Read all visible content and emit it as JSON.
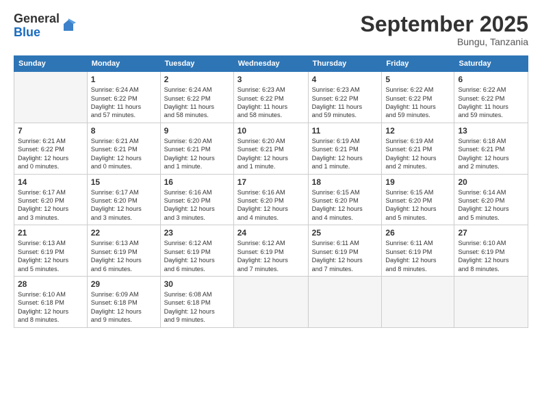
{
  "logo": {
    "general": "General",
    "blue": "Blue"
  },
  "title": "September 2025",
  "location": "Bungu, Tanzania",
  "days_of_week": [
    "Sunday",
    "Monday",
    "Tuesday",
    "Wednesday",
    "Thursday",
    "Friday",
    "Saturday"
  ],
  "weeks": [
    [
      {
        "day": "",
        "info": ""
      },
      {
        "day": "1",
        "info": "Sunrise: 6:24 AM\nSunset: 6:22 PM\nDaylight: 11 hours\nand 57 minutes."
      },
      {
        "day": "2",
        "info": "Sunrise: 6:24 AM\nSunset: 6:22 PM\nDaylight: 11 hours\nand 58 minutes."
      },
      {
        "day": "3",
        "info": "Sunrise: 6:23 AM\nSunset: 6:22 PM\nDaylight: 11 hours\nand 58 minutes."
      },
      {
        "day": "4",
        "info": "Sunrise: 6:23 AM\nSunset: 6:22 PM\nDaylight: 11 hours\nand 59 minutes."
      },
      {
        "day": "5",
        "info": "Sunrise: 6:22 AM\nSunset: 6:22 PM\nDaylight: 11 hours\nand 59 minutes."
      },
      {
        "day": "6",
        "info": "Sunrise: 6:22 AM\nSunset: 6:22 PM\nDaylight: 11 hours\nand 59 minutes."
      }
    ],
    [
      {
        "day": "7",
        "info": "Sunrise: 6:21 AM\nSunset: 6:22 PM\nDaylight: 12 hours\nand 0 minutes."
      },
      {
        "day": "8",
        "info": "Sunrise: 6:21 AM\nSunset: 6:21 PM\nDaylight: 12 hours\nand 0 minutes."
      },
      {
        "day": "9",
        "info": "Sunrise: 6:20 AM\nSunset: 6:21 PM\nDaylight: 12 hours\nand 1 minute."
      },
      {
        "day": "10",
        "info": "Sunrise: 6:20 AM\nSunset: 6:21 PM\nDaylight: 12 hours\nand 1 minute."
      },
      {
        "day": "11",
        "info": "Sunrise: 6:19 AM\nSunset: 6:21 PM\nDaylight: 12 hours\nand 1 minute."
      },
      {
        "day": "12",
        "info": "Sunrise: 6:19 AM\nSunset: 6:21 PM\nDaylight: 12 hours\nand 2 minutes."
      },
      {
        "day": "13",
        "info": "Sunrise: 6:18 AM\nSunset: 6:21 PM\nDaylight: 12 hours\nand 2 minutes."
      }
    ],
    [
      {
        "day": "14",
        "info": "Sunrise: 6:17 AM\nSunset: 6:20 PM\nDaylight: 12 hours\nand 3 minutes."
      },
      {
        "day": "15",
        "info": "Sunrise: 6:17 AM\nSunset: 6:20 PM\nDaylight: 12 hours\nand 3 minutes."
      },
      {
        "day": "16",
        "info": "Sunrise: 6:16 AM\nSunset: 6:20 PM\nDaylight: 12 hours\nand 3 minutes."
      },
      {
        "day": "17",
        "info": "Sunrise: 6:16 AM\nSunset: 6:20 PM\nDaylight: 12 hours\nand 4 minutes."
      },
      {
        "day": "18",
        "info": "Sunrise: 6:15 AM\nSunset: 6:20 PM\nDaylight: 12 hours\nand 4 minutes."
      },
      {
        "day": "19",
        "info": "Sunrise: 6:15 AM\nSunset: 6:20 PM\nDaylight: 12 hours\nand 5 minutes."
      },
      {
        "day": "20",
        "info": "Sunrise: 6:14 AM\nSunset: 6:20 PM\nDaylight: 12 hours\nand 5 minutes."
      }
    ],
    [
      {
        "day": "21",
        "info": "Sunrise: 6:13 AM\nSunset: 6:19 PM\nDaylight: 12 hours\nand 5 minutes."
      },
      {
        "day": "22",
        "info": "Sunrise: 6:13 AM\nSunset: 6:19 PM\nDaylight: 12 hours\nand 6 minutes."
      },
      {
        "day": "23",
        "info": "Sunrise: 6:12 AM\nSunset: 6:19 PM\nDaylight: 12 hours\nand 6 minutes."
      },
      {
        "day": "24",
        "info": "Sunrise: 6:12 AM\nSunset: 6:19 PM\nDaylight: 12 hours\nand 7 minutes."
      },
      {
        "day": "25",
        "info": "Sunrise: 6:11 AM\nSunset: 6:19 PM\nDaylight: 12 hours\nand 7 minutes."
      },
      {
        "day": "26",
        "info": "Sunrise: 6:11 AM\nSunset: 6:19 PM\nDaylight: 12 hours\nand 8 minutes."
      },
      {
        "day": "27",
        "info": "Sunrise: 6:10 AM\nSunset: 6:19 PM\nDaylight: 12 hours\nand 8 minutes."
      }
    ],
    [
      {
        "day": "28",
        "info": "Sunrise: 6:10 AM\nSunset: 6:18 PM\nDaylight: 12 hours\nand 8 minutes."
      },
      {
        "day": "29",
        "info": "Sunrise: 6:09 AM\nSunset: 6:18 PM\nDaylight: 12 hours\nand 9 minutes."
      },
      {
        "day": "30",
        "info": "Sunrise: 6:08 AM\nSunset: 6:18 PM\nDaylight: 12 hours\nand 9 minutes."
      },
      {
        "day": "",
        "info": ""
      },
      {
        "day": "",
        "info": ""
      },
      {
        "day": "",
        "info": ""
      },
      {
        "day": "",
        "info": ""
      }
    ]
  ]
}
